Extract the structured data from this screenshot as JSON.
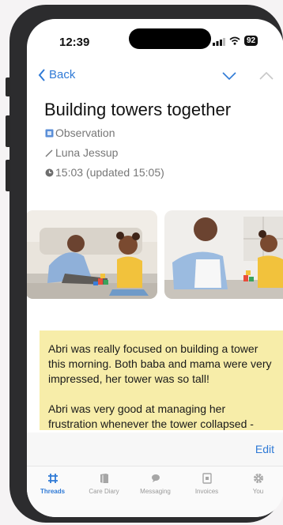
{
  "status": {
    "time": "12:39",
    "battery": "92"
  },
  "nav": {
    "back_label": "Back"
  },
  "post": {
    "title": "Building towers together",
    "type": "Observation",
    "author": "Luna Jessup",
    "time": "15:03 (updated 15:05)",
    "photos": [
      "photo-father-daughter-blocks-1",
      "photo-father-daughter-blocks-2"
    ],
    "paragraphs": [
      "Abri was really focused on building a tower this morning. Both baba and mama were very impressed, her tower was so tall!",
      "Abri was very good at managing her frustration whenever the tower collapsed -"
    ]
  },
  "actions": {
    "edit_label": "Edit"
  },
  "tabs": [
    {
      "label": "Threads",
      "icon": "threads-icon",
      "active": true
    },
    {
      "label": "Care Diary",
      "icon": "book-icon",
      "active": false
    },
    {
      "label": "Messaging",
      "icon": "chat-bubble-icon",
      "active": false
    },
    {
      "label": "Invoices",
      "icon": "invoice-icon",
      "active": false
    },
    {
      "label": "You",
      "icon": "gear-icon",
      "active": false
    }
  ],
  "colors": {
    "accent": "#2f7ad6",
    "note_bg": "#f7eda9",
    "muted": "#777777"
  }
}
